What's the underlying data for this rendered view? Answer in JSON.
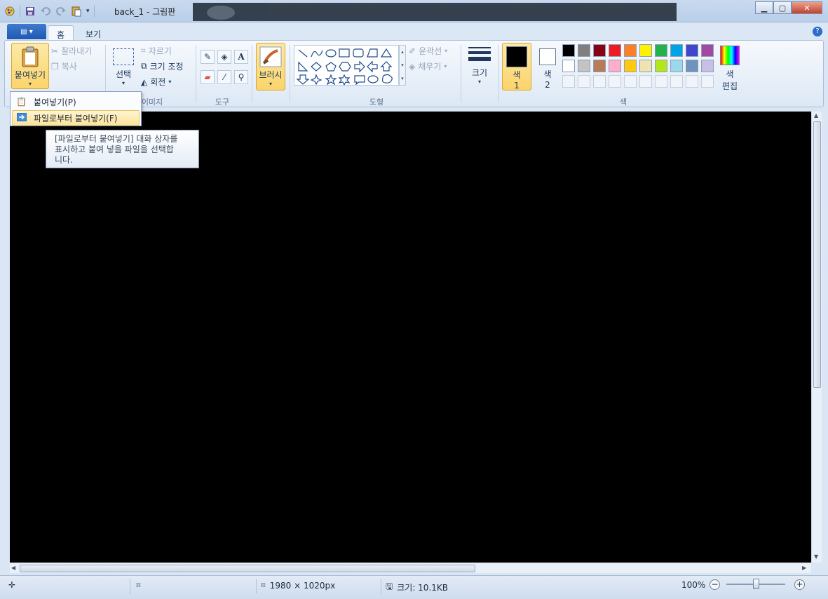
{
  "window": {
    "title": "back_1 - 그림판"
  },
  "tabs": [
    {
      "label": "홈",
      "active": true
    },
    {
      "label": "보기",
      "active": false
    }
  ],
  "clipboard": {
    "paste_label": "붙여넣기",
    "cut_label": "잘라내기",
    "copy_label": "복사"
  },
  "image_group": {
    "select_label": "선택",
    "crop_label": "자르기",
    "resize_label": "크기 조정",
    "rotate_label": "회전",
    "group_label": "이미지"
  },
  "tools_group": {
    "group_label": "도구"
  },
  "brush": {
    "label": "브러시"
  },
  "shapes_group": {
    "outline_label": "윤곽선",
    "fill_label": "채우기",
    "group_label": "도형"
  },
  "size": {
    "label": "크기"
  },
  "colors": {
    "color1_label": "색",
    "color1_num": "1",
    "color2_label": "색",
    "color2_num": "2",
    "edit_label_1": "색",
    "edit_label_2": "편집",
    "group_label": "색",
    "color1_value": "#000000",
    "color2_value": "#ffffff",
    "palette_row1": [
      "#000000",
      "#7f7f7f",
      "#880015",
      "#ed1c24",
      "#ff7f27",
      "#fff200",
      "#22b14c",
      "#00a2e8",
      "#3f48cc",
      "#a349a4"
    ],
    "palette_row2": [
      "#ffffff",
      "#c3c3c3",
      "#b97a57",
      "#ffaec9",
      "#ffc90e",
      "#efe4b0",
      "#b5e61d",
      "#99d9ea",
      "#7092be",
      "#c8bfe7"
    ]
  },
  "dropdown": {
    "item1": "붙여넣기(P)",
    "item2": "파일로부터 붙여넣기(F)"
  },
  "tooltip": {
    "line1": "[파일로부터 붙여넣기] 대화 상자를",
    "line2": "표시하고 붙여 넣을 파일을 선택합",
    "line3": "니다."
  },
  "status": {
    "dimensions": "1980 × 1020px",
    "filesize": "크기: 10.1KB",
    "zoom": "100%"
  }
}
